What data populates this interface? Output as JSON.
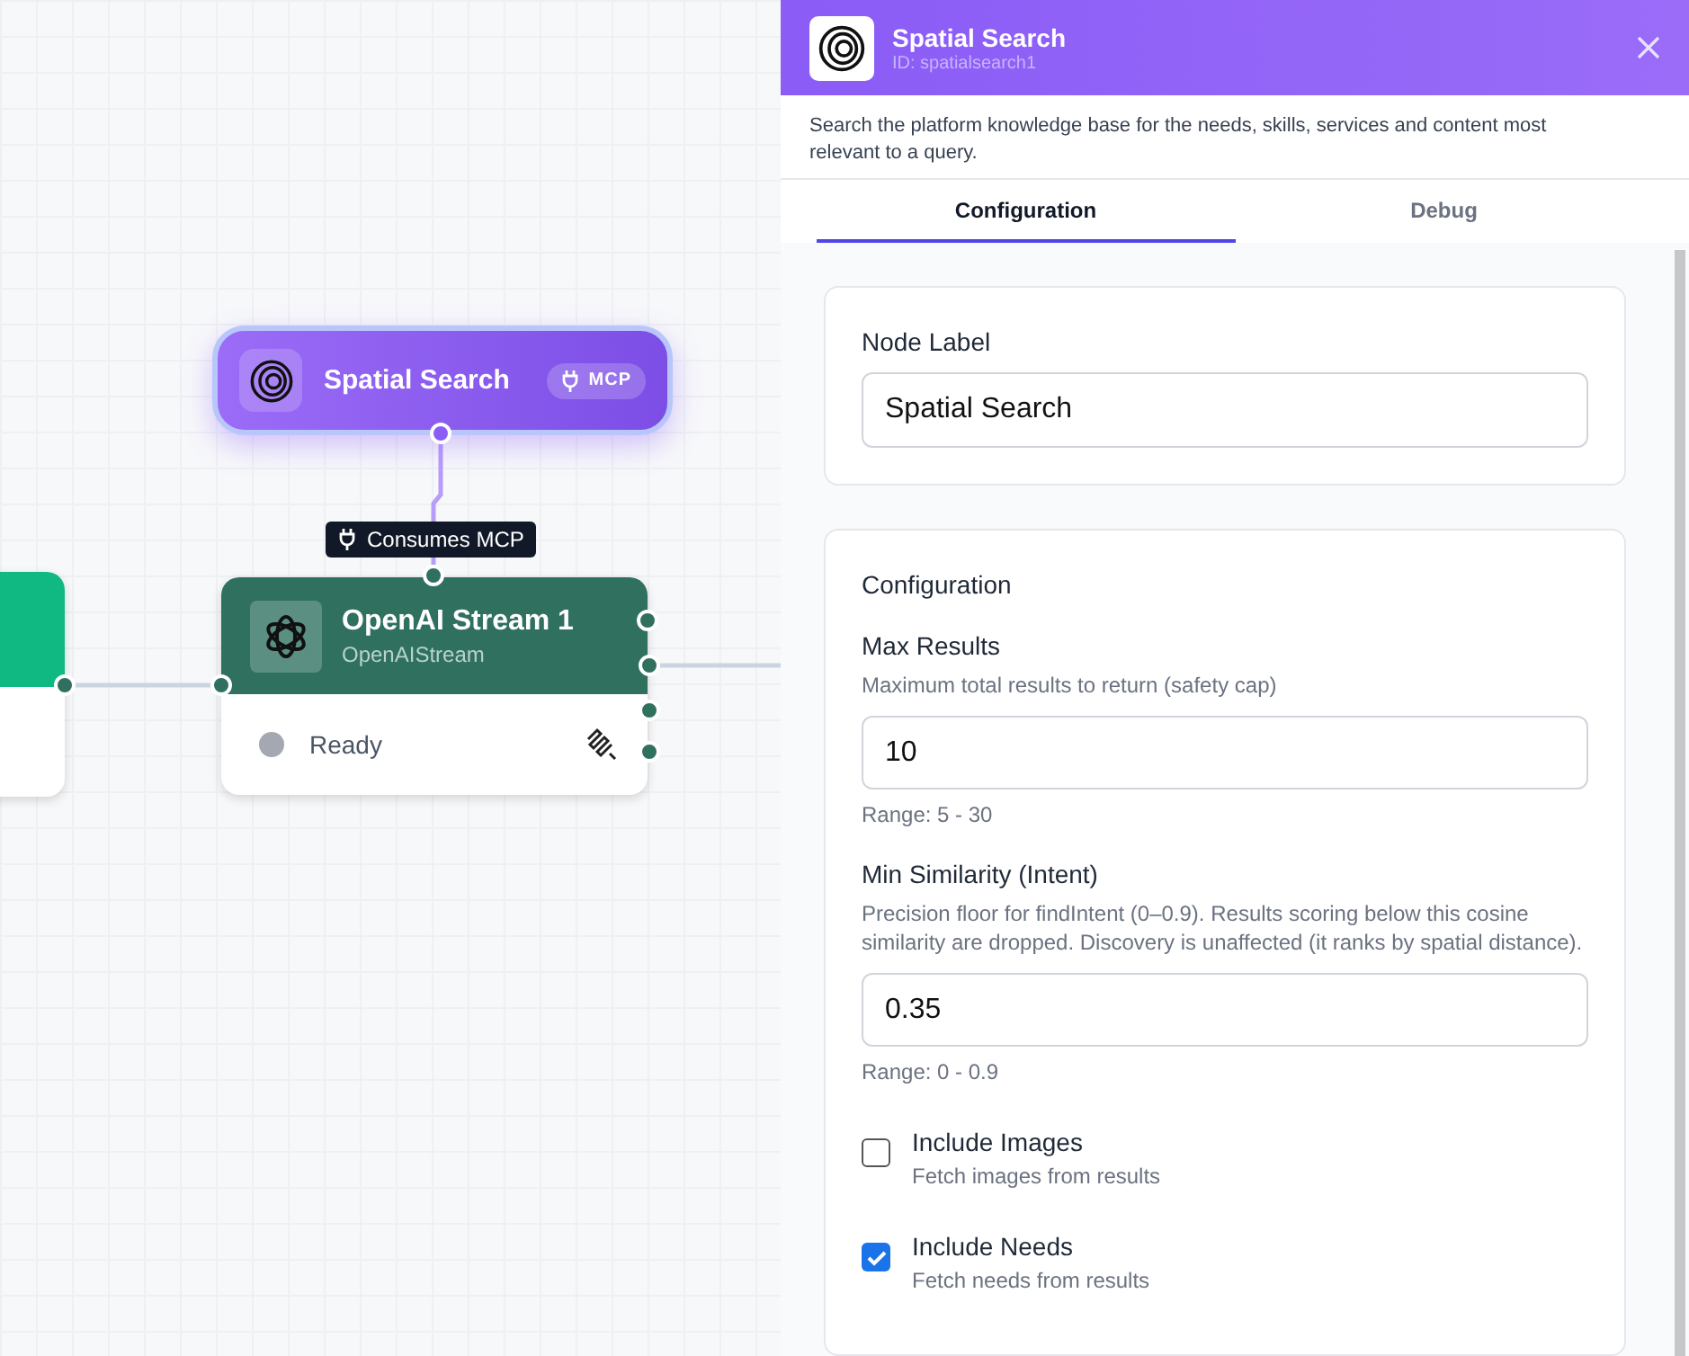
{
  "canvas": {
    "source_node": {
      "title": "Spatial Search",
      "badge": "MCP"
    },
    "tooltip": "Consumes MCP",
    "stream_node": {
      "title": "OpenAI Stream 1",
      "subtitle": "OpenAIStream",
      "status": "Ready"
    }
  },
  "panel": {
    "header": {
      "title": "Spatial Search",
      "id": "ID: spatialsearch1"
    },
    "description": "Search the platform knowledge base for the needs, skills, services and content most relevant to a query.",
    "tabs": [
      {
        "label": "Configuration",
        "selected": true
      },
      {
        "label": "Debug",
        "selected": false
      }
    ],
    "label_card": {
      "heading": "Node Label",
      "value": "Spatial Search"
    },
    "config_card": {
      "heading": "Configuration",
      "fields": [
        {
          "label": "Max Results",
          "help": "Maximum total results to return (safety cap)",
          "value": "10",
          "range": "Range: 5 - 30"
        },
        {
          "label": "Min Similarity (Intent)",
          "help": "Precision floor for findIntent (0–0.9). Results scoring below this cosine similarity are dropped. Discovery is unaffected (it ranks by spatial distance).",
          "value": "0.35",
          "range": "Range: 0 - 0.9"
        }
      ],
      "checkboxes": [
        {
          "label": "Include Images",
          "help": "Fetch images from results",
          "checked": false
        },
        {
          "label": "Include Needs",
          "help": "Fetch needs from results",
          "checked": true
        }
      ]
    }
  }
}
